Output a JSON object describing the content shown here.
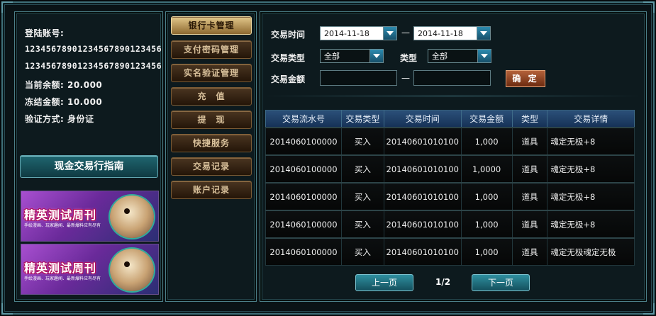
{
  "account": {
    "login_label": "登陆账号:",
    "account_line_1": "1234567890123456789012345​6",
    "account_line_2": "12345678901234567890123456",
    "balance": "当前余额: 20.000",
    "frozen": "冻结金额: 10.000",
    "verify": "验证方式: 身份证"
  },
  "guide_button": "现金交易行指南",
  "banners": [
    {
      "title": "精英测试周刊",
      "subtitle": "手绘漫画、玩家趣闻、最新爆料应有尽有"
    },
    {
      "title": "精英测试周刊",
      "subtitle": "手绘漫画、玩家趣闻、最新爆料应有尽有"
    }
  ],
  "menu": [
    {
      "label": "银行卡管理",
      "active": true
    },
    {
      "label": "支付密码管理",
      "active": false
    },
    {
      "label": "实名验证管理",
      "active": false
    },
    {
      "label": "充　值",
      "active": false
    },
    {
      "label": "提　现",
      "active": false
    },
    {
      "label": "快捷服务",
      "active": false
    },
    {
      "label": "交易记录",
      "active": false
    },
    {
      "label": "账户记录",
      "active": false
    }
  ],
  "filters": {
    "time_label": "交易时间",
    "date_from": "2014-11-18",
    "date_to": "2014-11-18",
    "type_label": "交易类型",
    "type_value": "全部",
    "category_label": "类型",
    "category_value": "全部",
    "amount_label": "交易金额",
    "dash": "—",
    "confirm": "确 定"
  },
  "table": {
    "headers": [
      "交易流水号",
      "交易类型",
      "交易时间",
      "交易金额",
      "类型",
      "交易详情"
    ],
    "rows": [
      [
        "2014060100000",
        "买入",
        "20140601010100",
        "1,000",
        "道具",
        "魂定无极+8"
      ],
      [
        "2014060100000",
        "买入",
        "20140601010100",
        "1,0000",
        "道具",
        "魂定无极+8"
      ],
      [
        "2014060100000",
        "买入",
        "20140601010100",
        "1,000",
        "道具",
        "魂定无极+8"
      ],
      [
        "2014060100000",
        "买入",
        "20140601010100",
        "1,000",
        "道具",
        "魂定无极+8"
      ],
      [
        "2014060100000",
        "买入",
        "20140601010100",
        "1,000",
        "道具",
        "魂定无极魂定无极"
      ]
    ]
  },
  "pagination": {
    "prev": "上一页",
    "indicator": "1/2",
    "next": "下一页"
  }
}
